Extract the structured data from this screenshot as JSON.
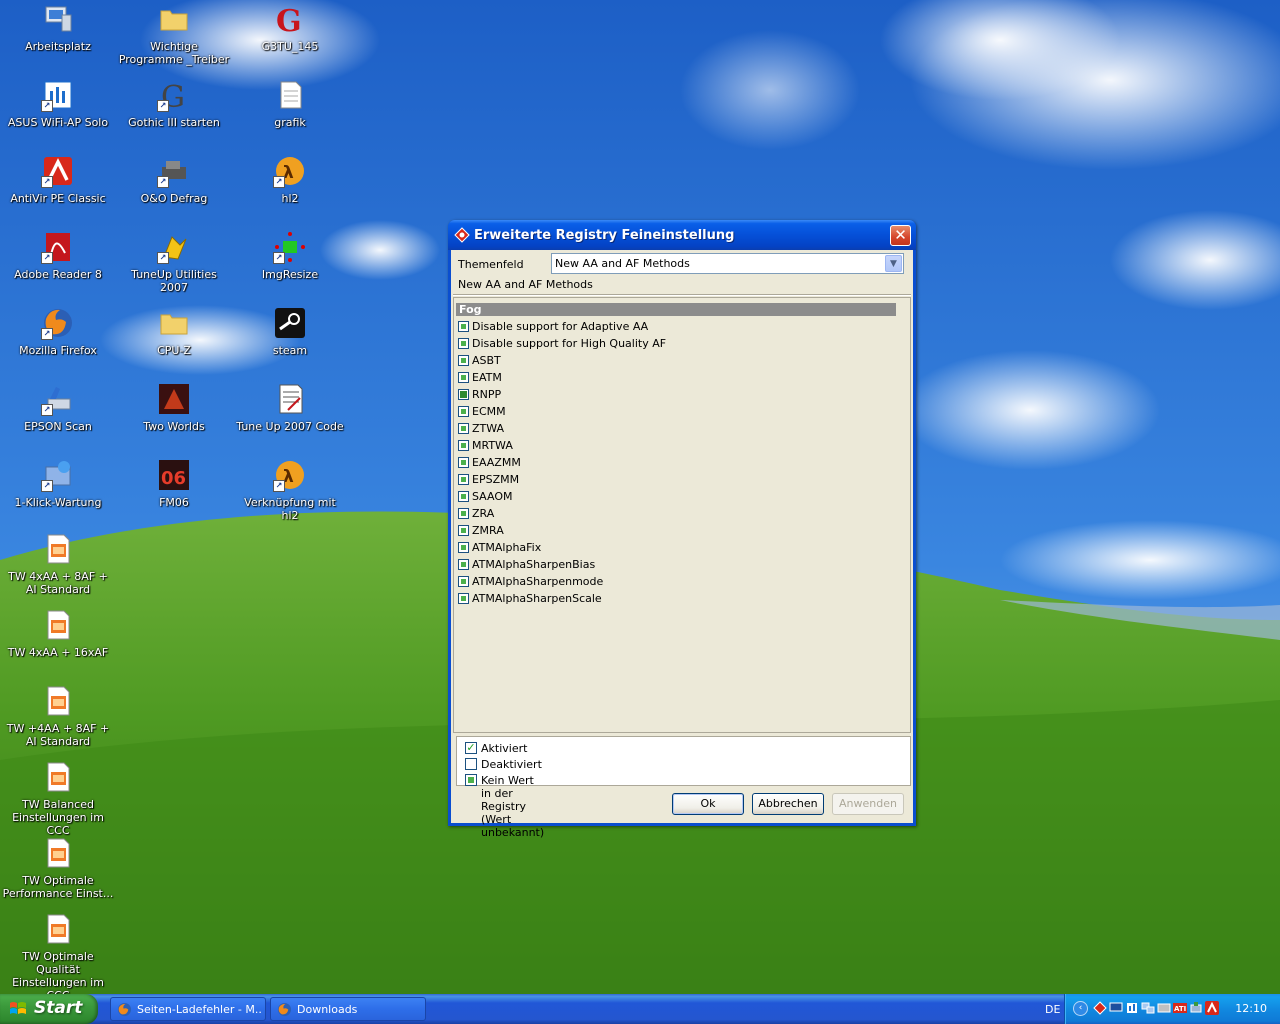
{
  "desktop": {
    "icons": [
      {
        "label": "Arbeitsplatz"
      },
      {
        "label": "Wichtige Programme _Treiber"
      },
      {
        "label": "G3TU_145"
      },
      {
        "label": "ASUS WiFi-AP Solo"
      },
      {
        "label": "Gothic III starten"
      },
      {
        "label": "grafik"
      },
      {
        "label": "AntiVir PE Classic"
      },
      {
        "label": "O&O Defrag"
      },
      {
        "label": "hl2"
      },
      {
        "label": "Adobe Reader 8"
      },
      {
        "label": "TuneUp Utilities 2007"
      },
      {
        "label": "ImgResize"
      },
      {
        "label": "Mozilla Firefox"
      },
      {
        "label": "CPU-Z"
      },
      {
        "label": "steam"
      },
      {
        "label": "EPSON Scan"
      },
      {
        "label": "Two Worlds"
      },
      {
        "label": "Tune Up 2007 Code"
      },
      {
        "label": "1-Klick-Wartung"
      },
      {
        "label": "FM06"
      },
      {
        "label": "Verknüpfung mit hl2"
      },
      {
        "label": "TW 4xAA + 8AF + AI Standard"
      },
      {
        "label": "TW 4xAA + 16xAF"
      },
      {
        "label": "TW +4AA + 8AF + AI Standard"
      },
      {
        "label": "TW Balanced Einstellungen im CCC"
      },
      {
        "label": "TW Optimale Performance Einst..."
      },
      {
        "label": "TW Optimale Qualität Einstellungen im CCC"
      }
    ]
  },
  "dialog": {
    "title": "Erweiterte Registry Feineinstellung",
    "theme_label": "Themenfeld",
    "theme_value": "New AA and AF Methods",
    "theme_description": "New AA and AF Methods",
    "group_header": "Fog",
    "settings": [
      {
        "label": "Disable support for Adaptive AA",
        "state": "unknown"
      },
      {
        "label": "Disable support for High Quality AF",
        "state": "unknown"
      },
      {
        "label": "ASBT",
        "state": "unknown"
      },
      {
        "label": "EATM",
        "state": "unknown"
      },
      {
        "label": "RNPP",
        "state": "unknown-dark"
      },
      {
        "label": "ECMM",
        "state": "unknown"
      },
      {
        "label": "ZTWA",
        "state": "unknown"
      },
      {
        "label": "MRTWA",
        "state": "unknown"
      },
      {
        "label": "EAAZMM",
        "state": "unknown"
      },
      {
        "label": "EPSZMM",
        "state": "unknown"
      },
      {
        "label": "SAAOM",
        "state": "unknown"
      },
      {
        "label": "ZRA",
        "state": "unknown"
      },
      {
        "label": "ZMRA",
        "state": "unknown"
      },
      {
        "label": "ATMAlphaFix",
        "state": "unknown"
      },
      {
        "label": "ATMAlphaSharpenBias",
        "state": "unknown"
      },
      {
        "label": "ATMAlphaSharpenmode",
        "state": "unknown"
      },
      {
        "label": "ATMAlphaSharpenScale",
        "state": "unknown"
      }
    ],
    "legend": {
      "checked": "Aktiviert",
      "unchecked": "Deaktiviert",
      "unknown": "Kein Wert in der Registry (Wert unbekannt)"
    },
    "buttons": {
      "ok": "Ok",
      "cancel": "Abbrechen",
      "apply": "Anwenden"
    },
    "close_glyph": "✕"
  },
  "taskbar": {
    "start_label": "Start",
    "tasks": [
      {
        "label": "Seiten-Ladefehler - M..."
      },
      {
        "label": "Downloads"
      }
    ],
    "language": "DE",
    "clock": "12:10"
  },
  "colors": {
    "xp_blue": "#0550d8",
    "dialog_face": "#ece9d8",
    "start_green": "#3c9a3c",
    "unknown_green": "#4cb04c"
  }
}
